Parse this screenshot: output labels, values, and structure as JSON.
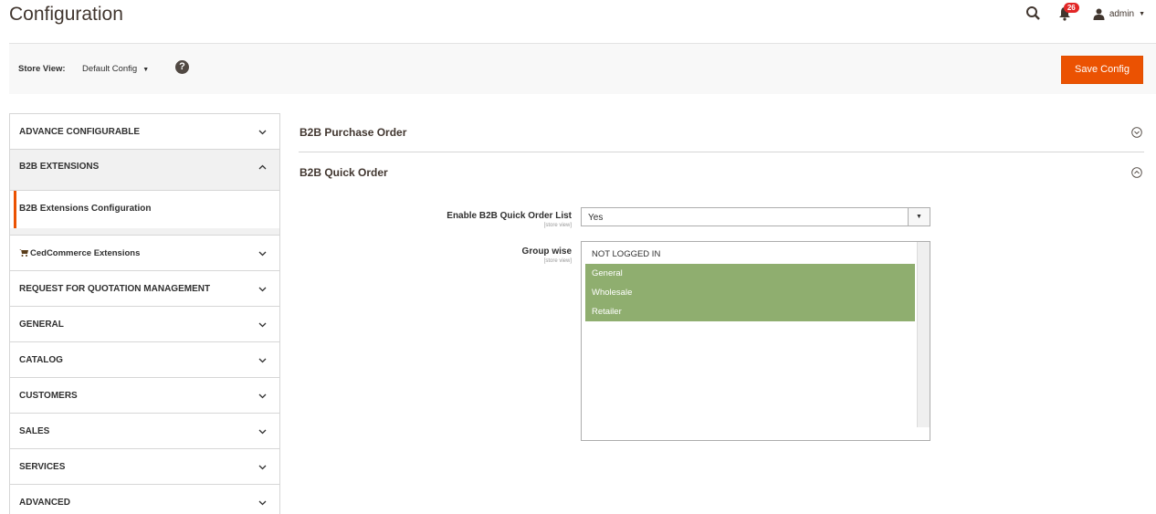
{
  "header": {
    "title": "Configuration",
    "notification_count": "26",
    "user": "admin"
  },
  "store_bar": {
    "label": "Store View:",
    "selected": "Default Config",
    "save_label": "Save Config"
  },
  "sidebar": {
    "items": [
      {
        "label": "ADVANCE CONFIGURABLE"
      },
      {
        "label": "B2B EXTENSIONS",
        "sub": "B2B Extensions Configuration"
      },
      {
        "label": "CedCommerce Extensions"
      },
      {
        "label": "REQUEST FOR QUOTATION MANAGEMENT"
      },
      {
        "label": "GENERAL"
      },
      {
        "label": "CATALOG"
      },
      {
        "label": "CUSTOMERS"
      },
      {
        "label": "SALES"
      },
      {
        "label": "SERVICES"
      },
      {
        "label": "ADVANCED"
      }
    ]
  },
  "sections": [
    {
      "title": "B2B Purchase Order"
    },
    {
      "title": "B2B Quick Order"
    }
  ],
  "fields": {
    "enable": {
      "label": "Enable B2B Quick Order List",
      "scope": "[store view]",
      "value": "Yes"
    },
    "group": {
      "label": "Group wise",
      "scope": "[store view]",
      "options": [
        {
          "label": "NOT LOGGED IN",
          "selected": false
        },
        {
          "label": "General",
          "selected": true
        },
        {
          "label": "Wholesale",
          "selected": true
        },
        {
          "label": "Retailer",
          "selected": true
        }
      ]
    }
  },
  "colors": {
    "accent": "#eb5202",
    "selected_option": "#8fae6f"
  }
}
